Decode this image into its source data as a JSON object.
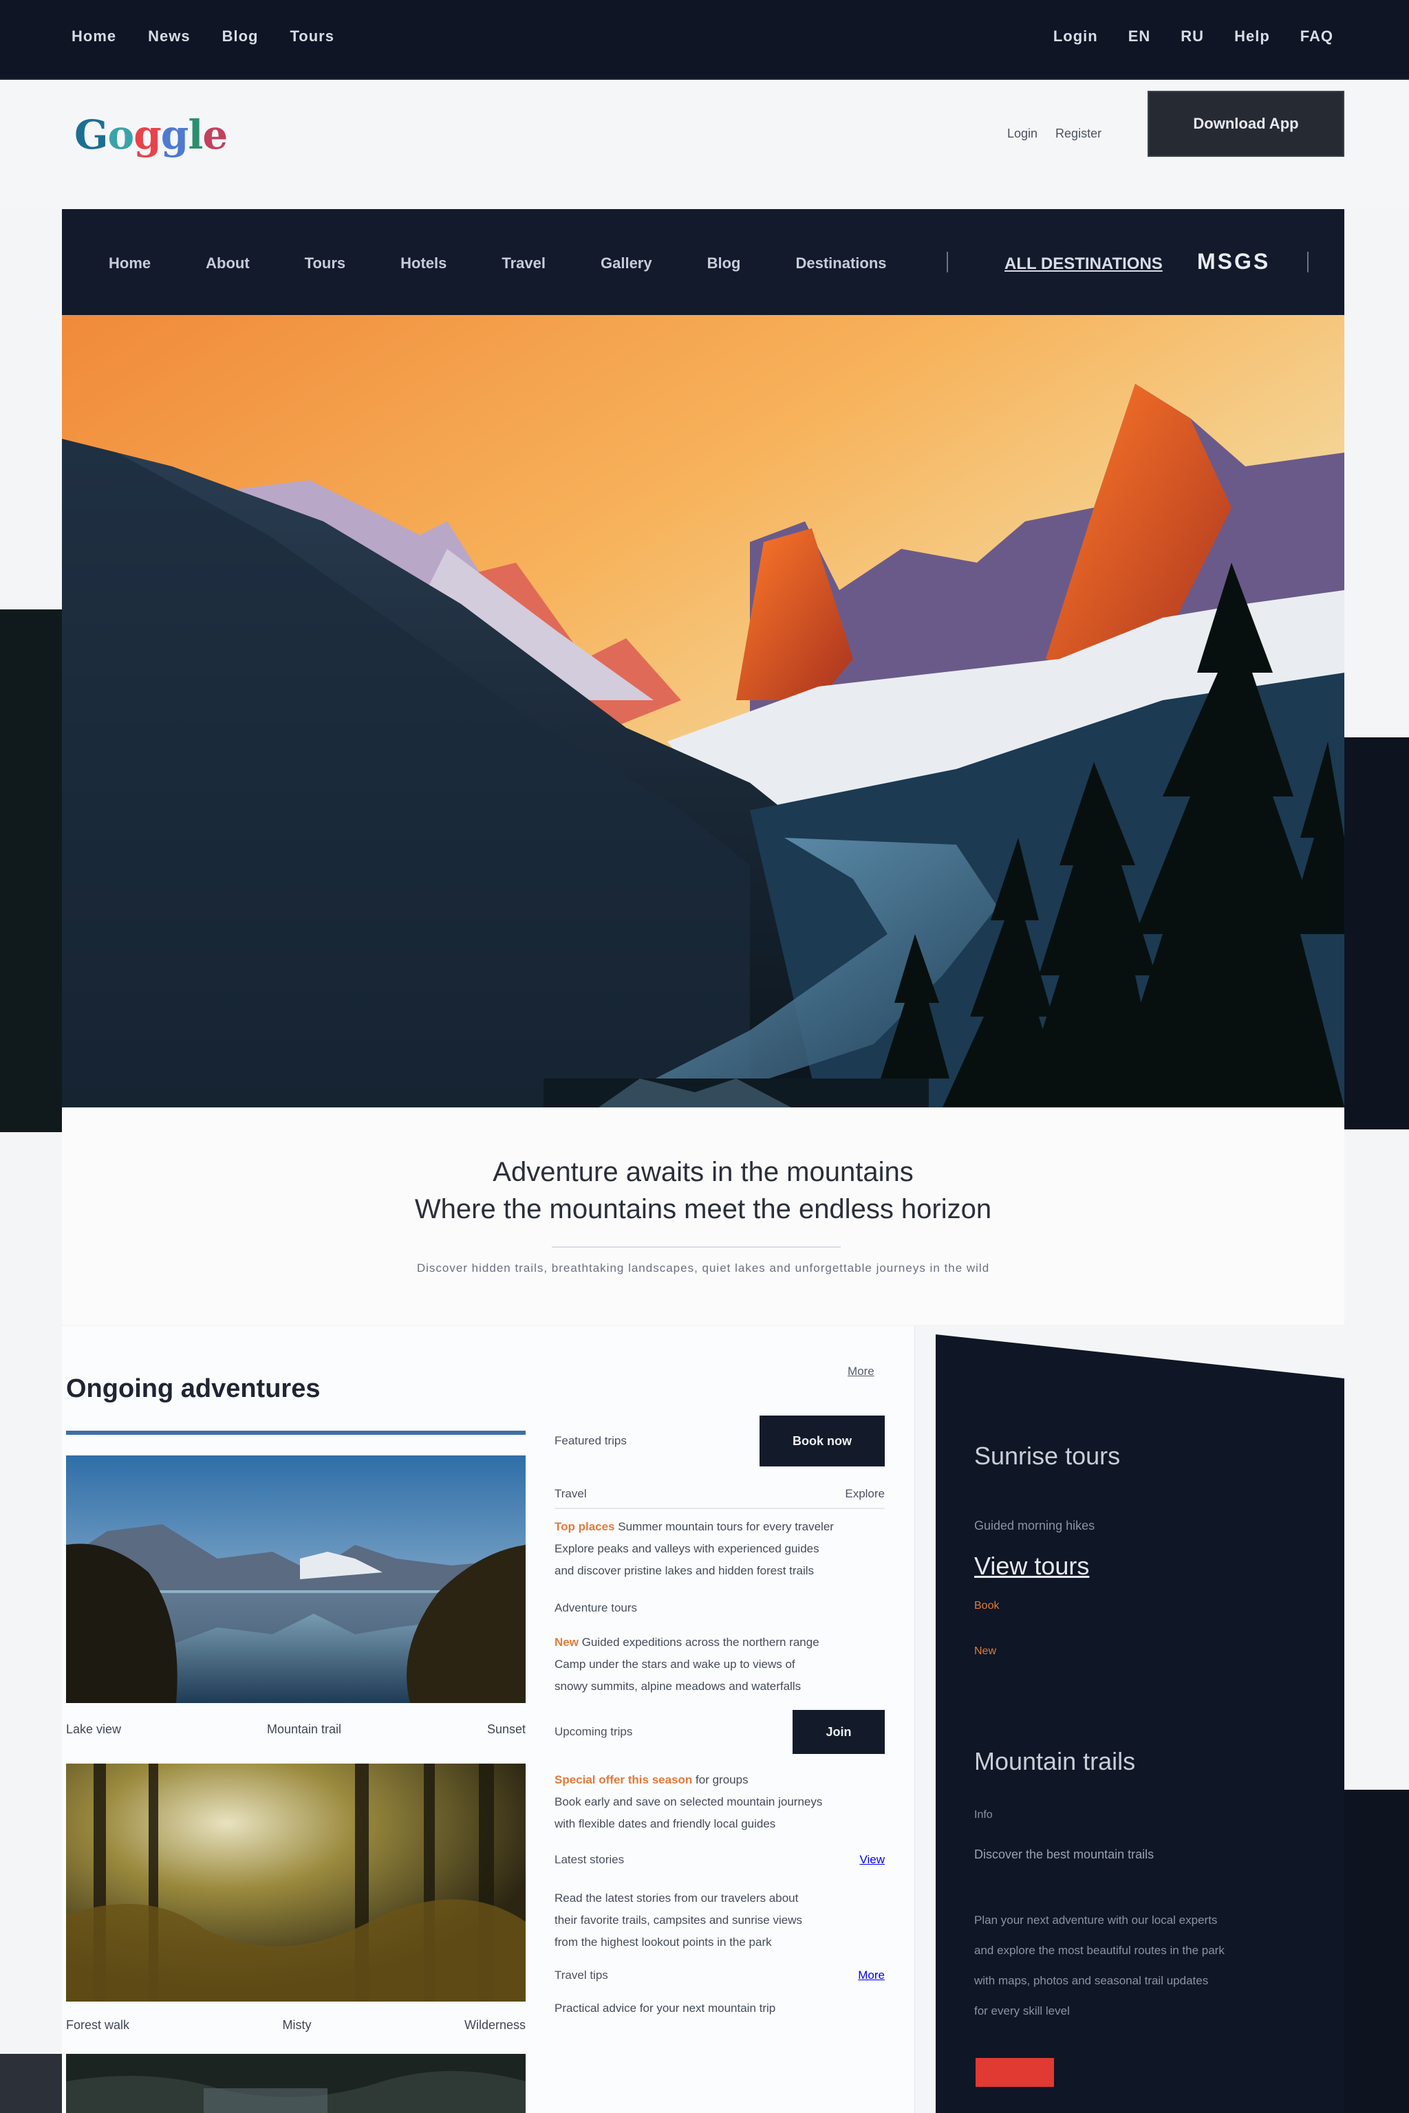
{
  "topbar": {
    "left_links": [
      "Home",
      "News",
      "Blog",
      "Tours"
    ],
    "right_links": [
      "Login",
      "EN",
      "RU",
      "Help",
      "FAQ"
    ]
  },
  "header": {
    "logo_letters": [
      "G",
      "o",
      "g",
      "g",
      "l",
      "e"
    ],
    "links": [
      "Login",
      "Register"
    ],
    "cta_label": "Download App"
  },
  "mainnav": {
    "items": [
      "Home",
      "About",
      "Tours",
      "Hotels",
      "Travel",
      "Gallery",
      "Blog",
      "Destinations"
    ],
    "feature": "ALL DESTINATIONS",
    "brand": "MSGS"
  },
  "intro": {
    "line1": "Adventure awaits in the mountains",
    "line2": "Where the mountains meet the endless horizon",
    "small": "Discover hidden trails, breathtaking landscapes, quiet lakes and unforgettable journeys in the wild"
  },
  "content": {
    "title": "Ongoing adventures",
    "corner": "More",
    "caption_row1": [
      "Lake view",
      "Mountain trail",
      "Sunset"
    ],
    "caption_row2": [
      "Forest walk",
      "Misty",
      "Wilderness"
    ],
    "section1_label": "Featured trips",
    "section1_button": "Book now",
    "row_a_left": "Travel",
    "row_a_right": "Explore",
    "para1_hl": "Top places",
    "para1_rest": "Summer mountain tours for every traveler",
    "para1_lines": [
      "Explore peaks and valleys with experienced guides",
      "and discover pristine lakes and hidden forest trails"
    ],
    "row_b_left": "Adventure tours",
    "para2_hl": "New",
    "para2_rest": "Guided expeditions across the northern range",
    "para2_lines": [
      "Camp under the stars and wake up to views of",
      "snowy summits, alpine meadows and waterfalls"
    ],
    "section2_label": "Upcoming trips",
    "section2_button": "Join",
    "para3_hl": "Special offer this season",
    "para3_rest": "for groups",
    "para3_lines": [
      "Book early and save on selected mountain journeys",
      "with flexible dates and friendly local guides"
    ],
    "row_c_left": "Latest stories",
    "row_c_right": "View",
    "para4_lines": [
      "Read the latest stories from our travelers about",
      "their favorite trails, campsites and sunrise views",
      "from the highest lookout points in the park"
    ],
    "row_d_left": "Travel tips",
    "row_d_right": "More",
    "para5_line": "Practical advice for your next mountain trip"
  },
  "sidebar": {
    "heading1": "Sunrise tours",
    "meta1": "Guided morning hikes",
    "heading2": "View tours",
    "tag1": "Book",
    "tag2": "New",
    "heading3": "Mountain trails",
    "meta2": "Info",
    "meta3": "Discover the best mountain trails",
    "body_lines": [
      "Plan your next adventure with our local experts",
      "and explore the most beautiful routes in the park",
      "with maps, photos and seasonal trail updates",
      "for every skill level"
    ],
    "button_label": ""
  },
  "colors": {
    "dark_navy": "#121a2b",
    "accent_orange": "#e07a3a",
    "accent_blue": "#3d6fa6",
    "accent_red": "#e03a32"
  }
}
